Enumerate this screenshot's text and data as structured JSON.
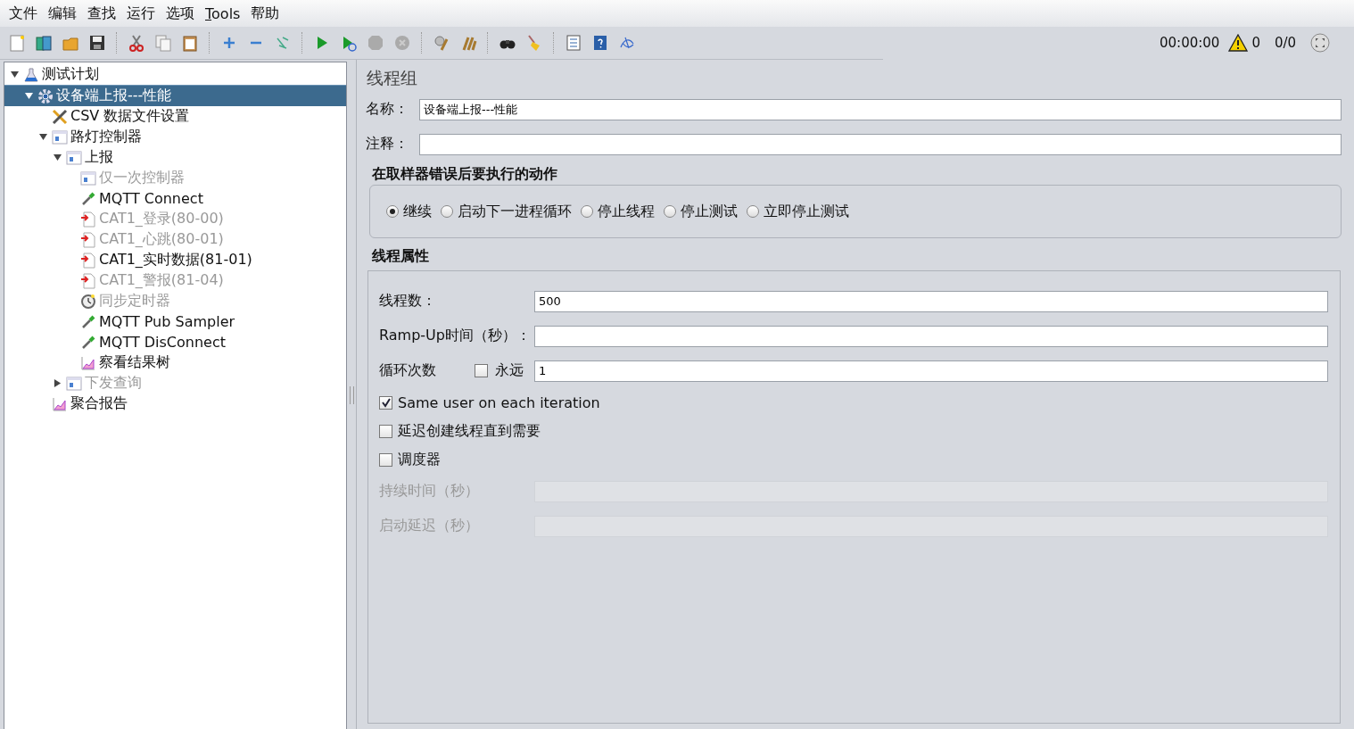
{
  "menu": [
    {
      "label": "文件",
      "mnemonic": false
    },
    {
      "label": "编辑",
      "mnemonic": false
    },
    {
      "label": "查找",
      "mnemonic": false
    },
    {
      "label": "运行",
      "mnemonic": false
    },
    {
      "label": "选项",
      "mnemonic": false
    },
    {
      "label": "Tools",
      "mnemonic": true
    },
    {
      "label": "帮助",
      "mnemonic": false
    }
  ],
  "status": {
    "elapsed": "00:00:00",
    "warnings": "0",
    "threads": "0/0"
  },
  "tree": [
    {
      "label": "测试计划",
      "kind": "plan",
      "expanded": true,
      "selected": false,
      "disabled": false,
      "children": [
        {
          "label": "设备端上报---性能",
          "kind": "thread-group",
          "expanded": true,
          "selected": true,
          "disabled": false,
          "children": [
            {
              "label": "CSV 数据文件设置",
              "kind": "config",
              "selected": false,
              "disabled": false
            },
            {
              "label": "路灯控制器",
              "kind": "controller",
              "expanded": true,
              "selected": false,
              "disabled": false,
              "children": [
                {
                  "label": "上报",
                  "kind": "controller",
                  "expanded": true,
                  "selected": false,
                  "disabled": false,
                  "children": [
                    {
                      "label": "仅一次控制器",
                      "kind": "controller",
                      "selected": false,
                      "disabled": true
                    },
                    {
                      "label": "MQTT Connect",
                      "kind": "mqtt",
                      "selected": false,
                      "disabled": false
                    },
                    {
                      "label": "CAT1_登录(80-00)",
                      "kind": "sampler",
                      "selected": false,
                      "disabled": true
                    },
                    {
                      "label": "CAT1_心跳(80-01)",
                      "kind": "sampler",
                      "selected": false,
                      "disabled": true
                    },
                    {
                      "label": "CAT1_实时数据(81-01)",
                      "kind": "sampler",
                      "selected": false,
                      "disabled": false
                    },
                    {
                      "label": "CAT1_警报(81-04)",
                      "kind": "sampler",
                      "selected": false,
                      "disabled": true
                    },
                    {
                      "label": "同步定时器",
                      "kind": "timer",
                      "selected": false,
                      "disabled": true
                    },
                    {
                      "label": "MQTT Pub Sampler",
                      "kind": "mqtt",
                      "selected": false,
                      "disabled": false
                    },
                    {
                      "label": "MQTT DisConnect",
                      "kind": "mqtt",
                      "selected": false,
                      "disabled": false
                    },
                    {
                      "label": "察看结果树",
                      "kind": "listener",
                      "selected": false,
                      "disabled": false
                    }
                  ]
                },
                {
                  "label": "下发查询",
                  "kind": "controller",
                  "expanded": false,
                  "selected": false,
                  "disabled": true
                }
              ]
            },
            {
              "label": "聚合报告",
              "kind": "listener",
              "selected": false,
              "disabled": false
            }
          ]
        }
      ]
    }
  ],
  "panel": {
    "title": "线程组",
    "name_field": {
      "label": "名称：",
      "value": "设备端上报---性能"
    },
    "comment_field": {
      "label": "注释："
    },
    "error_action": {
      "title": "在取样器错误后要执行的动作",
      "options": [
        {
          "label": "继续",
          "selected": true
        },
        {
          "label": "启动下一进程循环",
          "selected": false
        },
        {
          "label": "停止线程",
          "selected": false
        },
        {
          "label": "停止测试",
          "selected": false
        },
        {
          "label": "立即停止测试",
          "selected": false
        }
      ]
    },
    "thread_properties": {
      "title": "线程属性",
      "rows": [
        {
          "kind": "field",
          "label": "线程数：",
          "value": "500",
          "disabled": false
        },
        {
          "kind": "field",
          "label": "Ramp-Up时间（秒）：",
          "disabled": false
        },
        {
          "kind": "loop",
          "label": "循环次数",
          "forever": {
            "label": "永远",
            "checked": false
          },
          "value": "1"
        },
        {
          "kind": "checkbox",
          "label": "Same user on each iteration",
          "checked": true
        },
        {
          "kind": "checkbox",
          "label": "延迟创建线程直到需要",
          "checked": false
        },
        {
          "kind": "checkbox",
          "label": "调度器",
          "checked": false
        },
        {
          "kind": "field",
          "label": "持续时间（秒）",
          "disabled": true
        },
        {
          "kind": "field",
          "label": "启动延迟（秒）",
          "disabled": true
        }
      ]
    }
  }
}
